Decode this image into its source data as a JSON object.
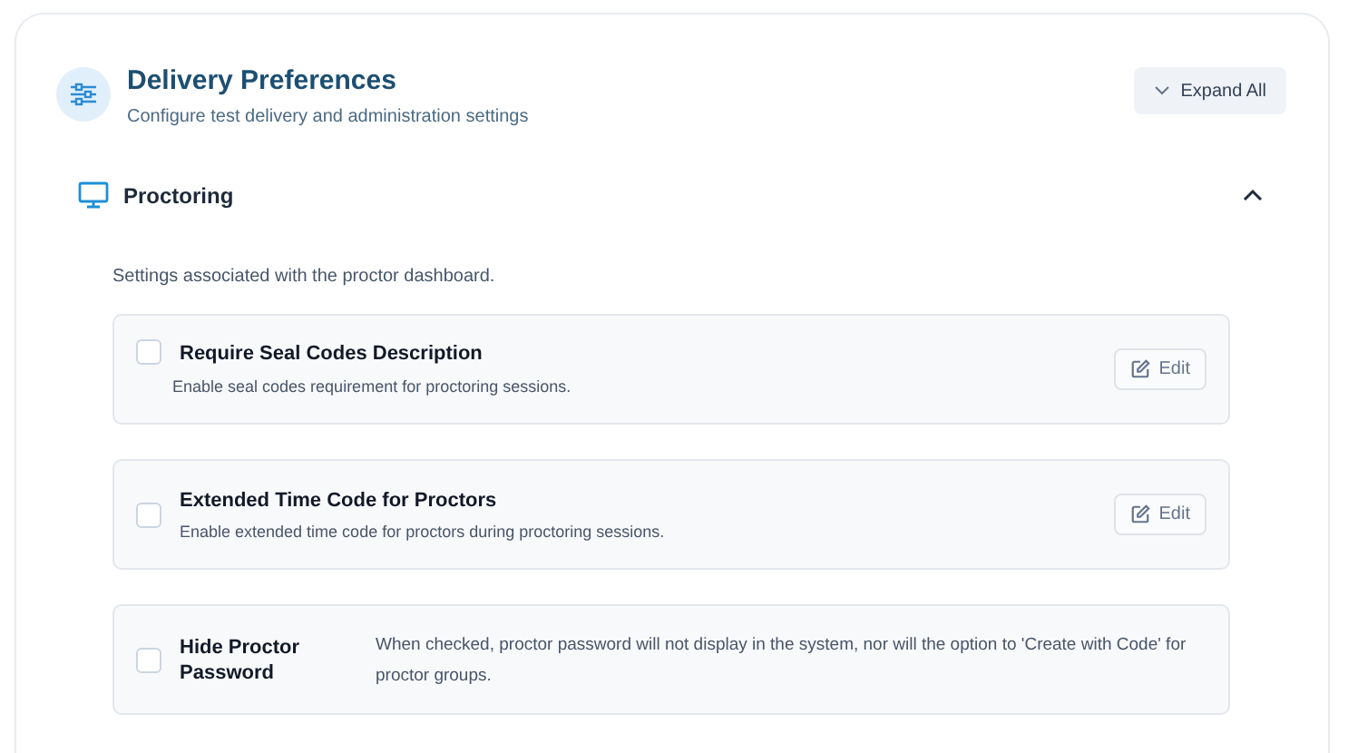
{
  "header": {
    "title": "Delivery Preferences",
    "subtitle": "Configure test delivery and administration settings",
    "expand_button": "Expand All"
  },
  "section": {
    "title": "Proctoring",
    "expanded": true,
    "description": "Settings associated with the proctor dashboard.",
    "settings": [
      {
        "kind": "stacked",
        "title": "Require Seal Codes Description",
        "description": "Enable seal codes requirement for proctoring sessions.",
        "checked": false,
        "edit_label": "Edit"
      },
      {
        "kind": "stacked",
        "title": "Extended Time Code for Proctors",
        "description": "Enable extended time code for proctors during proctoring sessions.",
        "checked": false,
        "edit_label": "Edit"
      },
      {
        "kind": "side",
        "title": "Hide Proctor Password",
        "description": "When checked, proctor password will not display in the system, nor will the option to 'Create with Code' for proctor groups.",
        "checked": false
      }
    ]
  }
}
